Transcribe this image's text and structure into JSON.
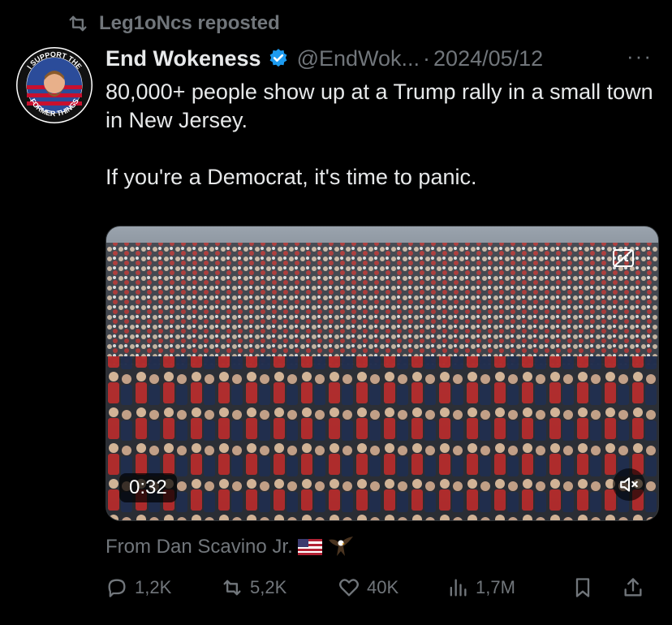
{
  "repost": {
    "text": "Leg1oNcs reposted"
  },
  "author": {
    "name": "End Wokeness",
    "handle": "@EndWok...",
    "date": "2024/05/12",
    "avatar_text_top": "I SUPPORT THE",
    "avatar_text_bottom": "FORMER THINGS"
  },
  "tweet": {
    "line1": "80,000+ people show up at a Trump rally in a small town in New Jersey.",
    "line2": "If you're a Democrat, it's time to panic."
  },
  "media": {
    "duration": "0:32"
  },
  "source": {
    "text": "From Dan Scavino Jr."
  },
  "stats": {
    "replies": "1,2K",
    "reposts": "5,2K",
    "likes": "40K",
    "views": "1,7M"
  },
  "icons": {
    "repost": "repost-icon",
    "verified": "verified-badge-icon",
    "more": "more-icon",
    "reply": "reply-icon",
    "like": "heart-icon",
    "views": "views-icon",
    "bookmark": "bookmark-icon",
    "share": "share-icon",
    "mute": "muted-speaker-icon",
    "captions": "captions-icon",
    "flag": "us-flag-icon",
    "eagle": "eagle-icon"
  },
  "colors": {
    "background": "#000000",
    "text": "#e7e9ea",
    "muted": "#71767b",
    "verified": "#1d9bf0"
  }
}
